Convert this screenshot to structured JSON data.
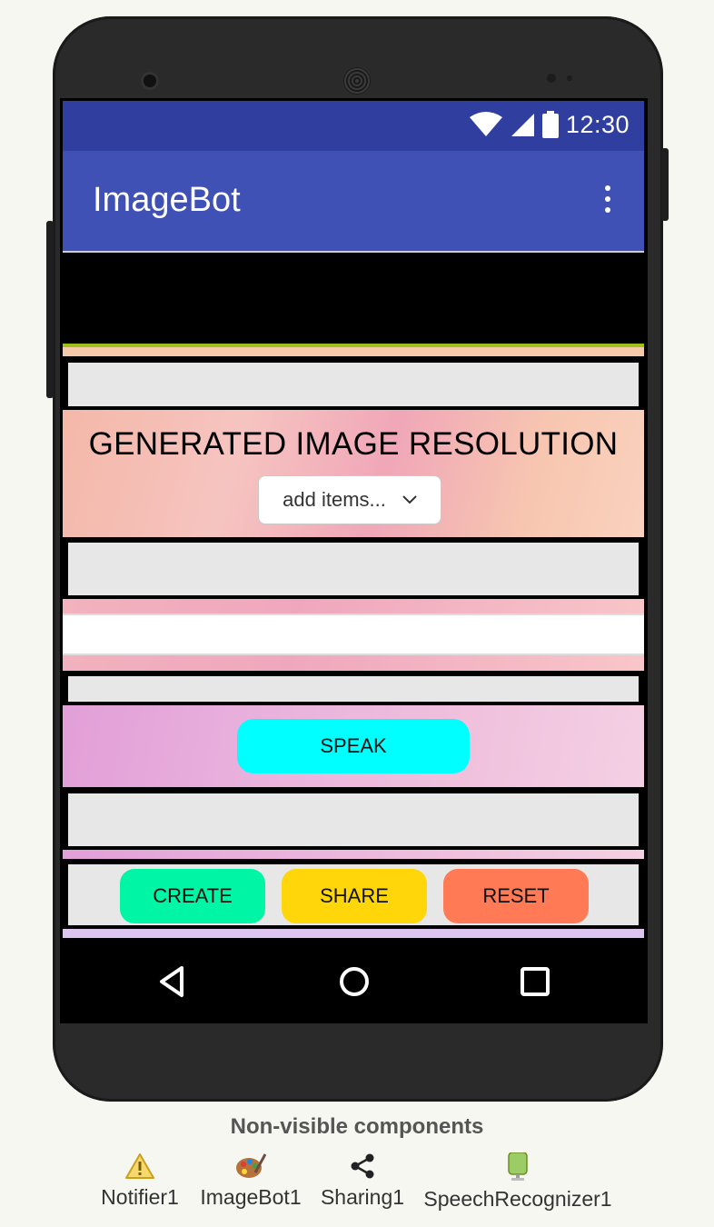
{
  "status_bar": {
    "time": "12:30",
    "icons": [
      "wifi-icon",
      "signal-icon",
      "battery-icon"
    ]
  },
  "app_bar": {
    "title": "ImageBot",
    "menu_icon": "overflow-menu-icon"
  },
  "form": {
    "resolution_label": "GENERATED IMAGE RESOLUTION",
    "resolution_dropdown": {
      "selected": "add items..."
    },
    "text_input": {
      "value": "",
      "placeholder": ""
    },
    "speak_button": "SPEAK",
    "create_button": "CREATE",
    "share_button": "SHARE",
    "reset_button": "RESET"
  },
  "nav_bar": {
    "back": "back-icon",
    "home": "home-icon",
    "recents": "recents-icon"
  },
  "non_visible": {
    "title": "Non-visible components",
    "items": [
      {
        "label": "Notifier1",
        "icon": "warning-icon"
      },
      {
        "label": "ImageBot1",
        "icon": "palette-icon"
      },
      {
        "label": "Sharing1",
        "icon": "share-icon"
      },
      {
        "label": "SpeechRecognizer1",
        "icon": "microphone-icon"
      }
    ]
  },
  "colors": {
    "status_bar": "#303f9f",
    "app_bar": "#3f51b5",
    "speak_button": "#00ffff",
    "create_button": "#00f5a5",
    "share_button": "#ffd60a",
    "reset_button": "#ff7a55"
  }
}
